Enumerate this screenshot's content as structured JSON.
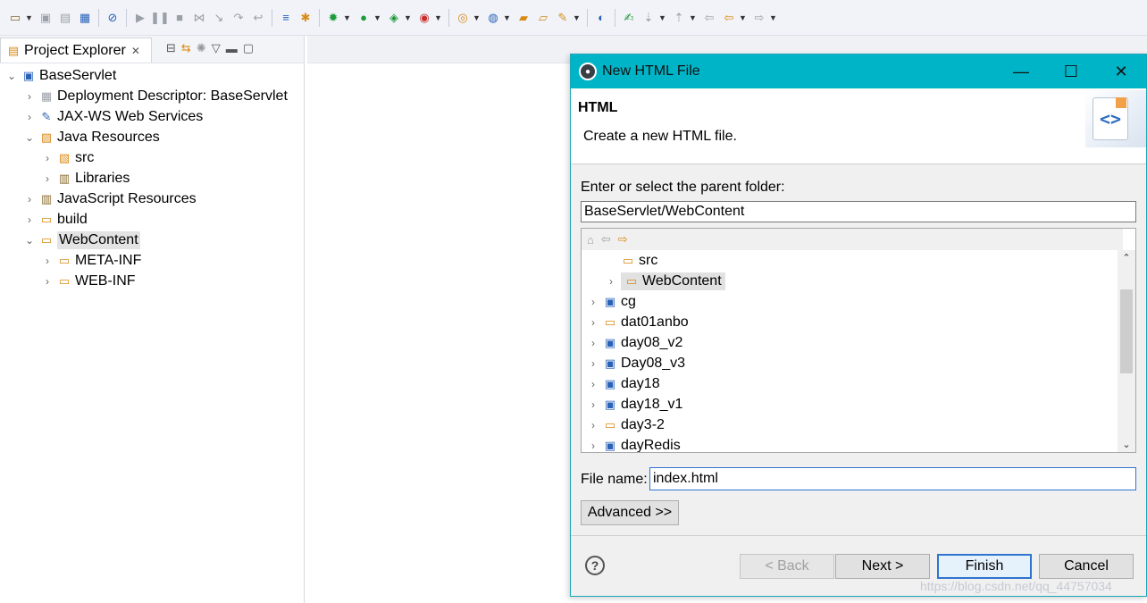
{
  "toolbar": {
    "icons": [
      "new-wizard-icon",
      "save-icon",
      "save-all-icon",
      "terminal-icon",
      "skip-breakpoints-icon",
      "resume-icon",
      "suspend-icon",
      "terminate-icon",
      "disconnect-icon",
      "step-into-icon",
      "step-over-icon",
      "step-return-icon",
      "java-icon",
      "debug-icon",
      "run-icon",
      "run-server-icon",
      "external-tools-icon",
      "new-server-icon",
      "new-class-icon",
      "open-type-icon",
      "open-task-icon",
      "search-icon",
      "web-browser-icon",
      "annotation-icon",
      "prev-annotation-icon",
      "last-edit-icon",
      "back-icon",
      "forward-icon"
    ]
  },
  "explorer": {
    "tab_title": "Project Explorer",
    "tree": [
      {
        "label": "BaseServlet",
        "icon": "project-icon",
        "expanded": true
      },
      {
        "label": "Deployment Descriptor: BaseServlet",
        "icon": "descriptor-icon",
        "expanded": false
      },
      {
        "label": "JAX-WS Web Services",
        "icon": "webservice-icon",
        "expanded": false
      },
      {
        "label": "Java Resources",
        "icon": "java-resources-icon",
        "expanded": true
      },
      {
        "label": "src",
        "icon": "package-folder-icon",
        "expanded": false
      },
      {
        "label": "Libraries",
        "icon": "library-icon",
        "expanded": false
      },
      {
        "label": "JavaScript Resources",
        "icon": "js-resources-icon",
        "expanded": false
      },
      {
        "label": "build",
        "icon": "folder-icon",
        "expanded": false
      },
      {
        "label": "WebContent",
        "icon": "folder-icon",
        "expanded": true,
        "selected": true
      },
      {
        "label": "META-INF",
        "icon": "folder-icon",
        "expanded": false
      },
      {
        "label": "WEB-INF",
        "icon": "folder-icon",
        "expanded": false
      }
    ]
  },
  "dialog": {
    "title": "New HTML File",
    "header_title": "HTML",
    "header_desc": "Create a new HTML file.",
    "parent_label": "Enter or select the parent folder:",
    "parent_value": "BaseServlet/WebContent",
    "folders": [
      {
        "label": "src",
        "expandable": false
      },
      {
        "label": "WebContent",
        "expandable": true,
        "selected": true
      },
      {
        "label": "cg",
        "expandable": true
      },
      {
        "label": "dat01anbo",
        "expandable": true
      },
      {
        "label": "day08_v2",
        "expandable": true
      },
      {
        "label": "Day08_v3",
        "expandable": true
      },
      {
        "label": "day18",
        "expandable": true
      },
      {
        "label": "day18_v1",
        "expandable": true
      },
      {
        "label": "day3-2",
        "expandable": true
      },
      {
        "label": "dayRedis",
        "expandable": true
      }
    ],
    "filename_label": "File name:",
    "filename_value": "index.html",
    "advanced_label": "Advanced >>",
    "back_label": "< Back",
    "next_label": "Next >",
    "finish_label": "Finish",
    "cancel_label": "Cancel",
    "help_label": "?"
  },
  "watermark": "https://blog.csdn.net/qq_44757034"
}
